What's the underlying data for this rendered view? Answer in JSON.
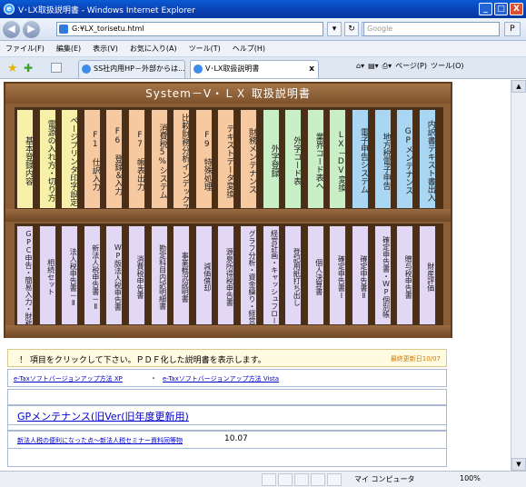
{
  "window": {
    "title": "V･LX取扱説明書 - Windows Internet Explorer",
    "minimize": "_",
    "maximize": "□",
    "close": "X"
  },
  "address_bar": {
    "back": "◀",
    "forward": "▶",
    "url": "G:¥LX_torisetu.html",
    "search_placeholder": "Google",
    "search_button": "P"
  },
  "menu": [
    "ファイル(F)",
    "編集(E)",
    "表示(V)",
    "お気に入り(A)",
    "ツール(T)",
    "ヘルプ(H)"
  ],
  "tabs": [
    {
      "label": "SS社内用HP－外部からは..."
    },
    {
      "label": "V･LX取扱説明書",
      "close": "x"
    }
  ],
  "toolbar": {
    "page_label": "ページ(P)",
    "tools_label": "ツール(O)"
  },
  "shelf": {
    "title": "System－V・ＬＸ 取扱説明書",
    "row1_books": [
      {
        "label": "基本登録内容",
        "color": "#f6f0a8"
      },
      {
        "label": "電源の入れ方・切り方",
        "color": "#f6f0a8"
      },
      {
        "label": "ページプリンタ印字設定",
        "color": "#f6f0a8"
      },
      {
        "label": "F1 仕訳入力",
        "color": "#f7c9a1"
      },
      {
        "label": "F6 登録＆入力",
        "color": "#f7c9a1"
      },
      {
        "label": "F7 帳表出力",
        "color": "#f7c9a1"
      },
      {
        "label": "消費税5%システム",
        "color": "#f7c9a1"
      },
      {
        "label": "比較財務分析インデックス",
        "color": "#f7c9a1"
      },
      {
        "label": "F9 特殊処理",
        "color": "#f7c9a1"
      },
      {
        "label": "テキストデータ変換",
        "color": "#f7c9a1"
      },
      {
        "label": "財務メンテナンス",
        "color": "#f7c9a1"
      },
      {
        "label": "外字登録",
        "color": "#c9efc6"
      },
      {
        "label": "外字コード表",
        "color": "#c9efc6"
      },
      {
        "label": "業界コード表へ",
        "color": "#c9efc6"
      },
      {
        "label": "LX－DV変換",
        "color": "#c9efc6"
      },
      {
        "label": "電子申告システム",
        "color": "#a9d6f2"
      },
      {
        "label": "地方税電子申告",
        "color": "#a9d6f2"
      },
      {
        "label": "GPメンテナンス",
        "color": "#a9d6f2"
      },
      {
        "label": "内訳書テキスト書出入",
        "color": "#a9d6f2"
      }
    ],
    "row2_books": [
      {
        "label": "GPC申告・簡易入力・財務諸表",
        "color": "#e2d7f5"
      },
      {
        "label": "相続セット",
        "color": "#e2d7f5"
      },
      {
        "label": "法人税申告書－Ⅱ",
        "color": "#e2d7f5"
      },
      {
        "label": "新法人税申告書－Ⅱ",
        "color": "#e2d7f5"
      },
      {
        "label": "WP版法人税申告書",
        "color": "#e2d7f5"
      },
      {
        "label": "消費税申告書",
        "color": "#e2d7f5"
      },
      {
        "label": "勘定科目内訳明細書",
        "color": "#e2d7f5"
      },
      {
        "label": "事業概況説明書",
        "color": "#e2d7f5"
      },
      {
        "label": "減価償却",
        "color": "#e2d7f5"
      },
      {
        "label": "源泉所得税申告書",
        "color": "#e2d7f5"
      },
      {
        "label": "グラフ分析・資金繰り・経営分析",
        "color": "#e2d7f5"
      },
      {
        "label": "経営計画・キャッシュフロー",
        "color": "#e2d7f5"
      },
      {
        "label": "登記用紙打ち出し",
        "color": "#e2d7f5"
      },
      {
        "label": "個人決算書",
        "color": "#e2d7f5"
      },
      {
        "label": "確定申告書Ⅰ",
        "color": "#e2d7f5"
      },
      {
        "label": "確定申告書Ⅱ",
        "color": "#e2d7f5"
      },
      {
        "label": "確定申告書・WP個別帳",
        "color": "#e2d7f5"
      },
      {
        "label": "贈与税申告書",
        "color": "#e2d7f5"
      },
      {
        "label": "財産評価",
        "color": "#e2d7f5"
      }
    ]
  },
  "notice": {
    "message": "！ 項目をクリックして下さい。ＰＤＦ化した説明書を表示します。",
    "updated": "最終更新日10/07"
  },
  "links": {
    "etax_xp": "e-Taxソフトバージョンアップ方法 XP",
    "separator": "・",
    "etax_vista": "e-Taxソフトバージョンアップ方法 Vista",
    "gp_maintenance": "GPメンテナンス(旧Ver(旧年度更新用)",
    "seminar": "新法人税の便利になった点～新法人税セミナー資料同等物",
    "seminar_date": "10.07"
  },
  "status": {
    "zone": "マイ コンピュータ",
    "zoom": "100%"
  }
}
